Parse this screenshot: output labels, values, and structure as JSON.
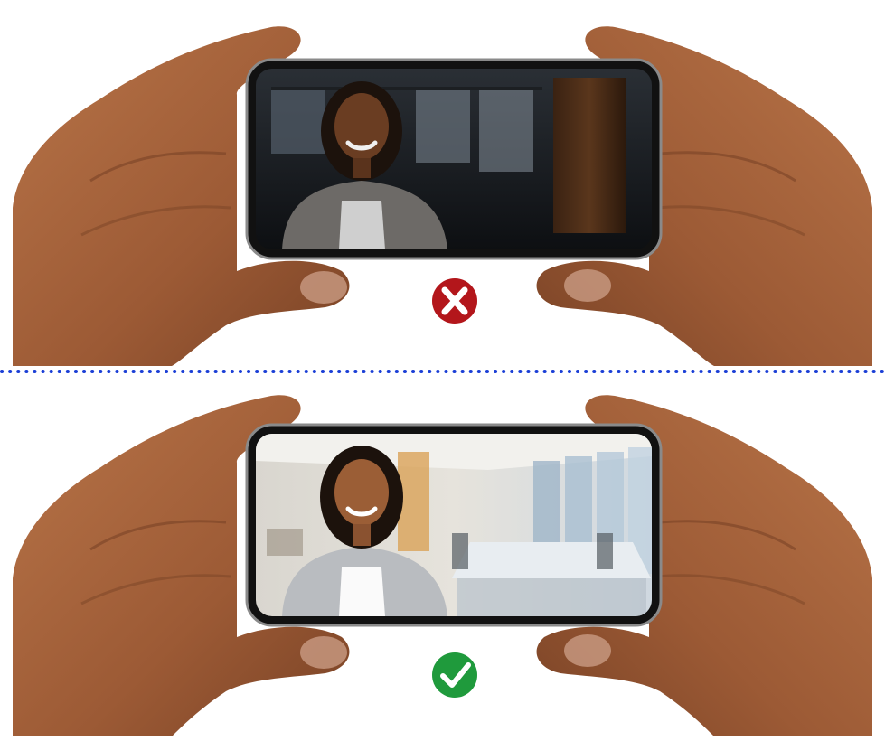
{
  "panels": [
    {
      "id": "bad-lighting",
      "verdict": "incorrect",
      "marker_icon": "x-mark-icon",
      "marker_color": "#b3161b",
      "scene": "dark"
    },
    {
      "id": "good-lighting",
      "verdict": "correct",
      "marker_icon": "check-mark-icon",
      "marker_color": "#1f9a3c",
      "scene": "bright"
    }
  ],
  "colors": {
    "divider": "#1b3fd6",
    "skin": "#a8673f",
    "skin_shadow": "#7d4527",
    "phone_frame": "#1a1a1a"
  }
}
